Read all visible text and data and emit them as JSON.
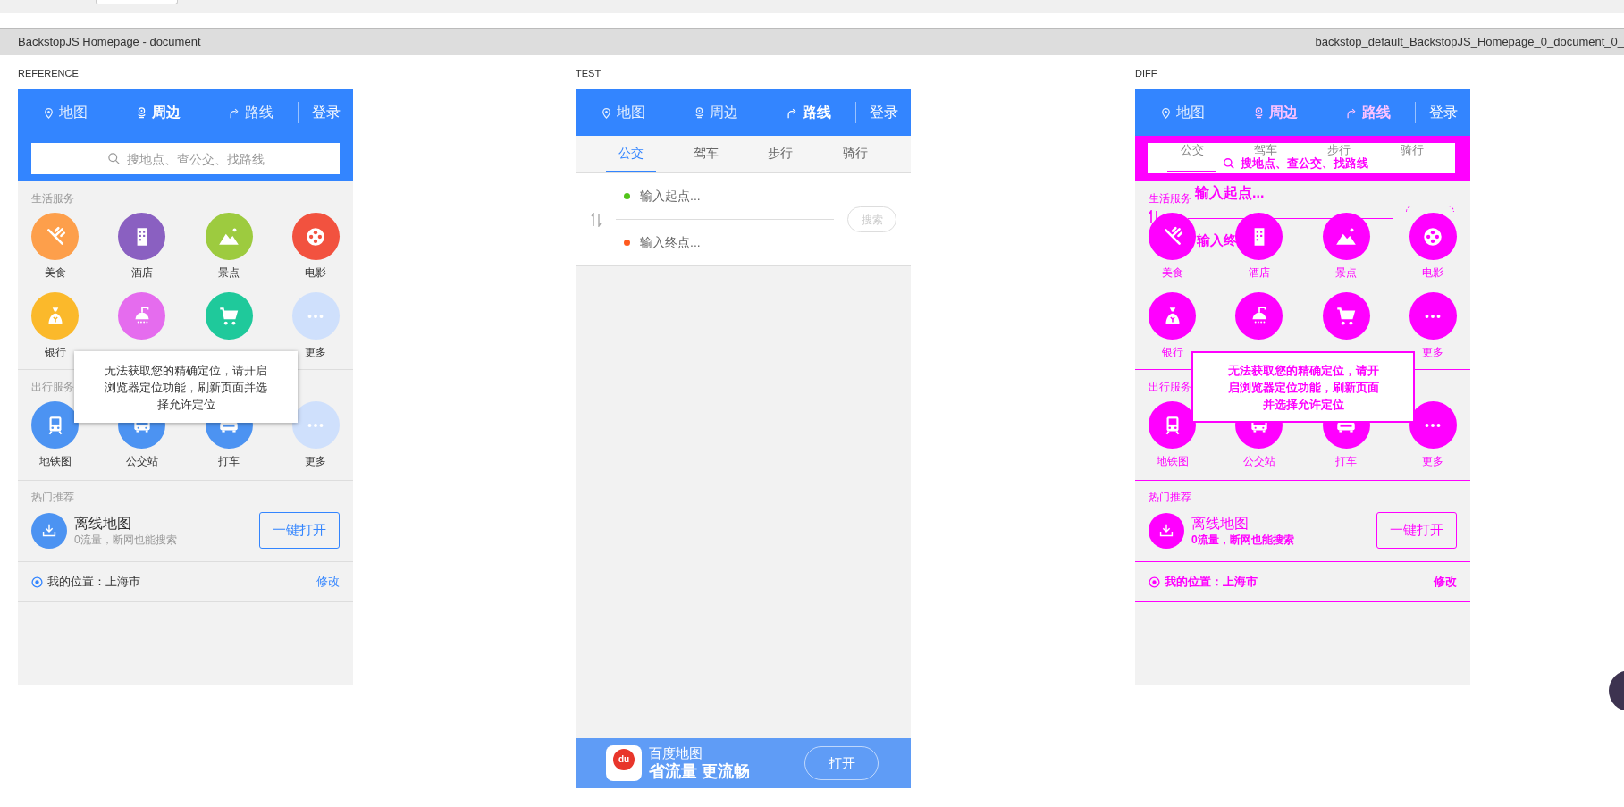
{
  "report": {
    "title": "BackstopJS Homepage - document",
    "file": "backstop_default_BackstopJS_Homepage_0_document_0_"
  },
  "panels": [
    {
      "kind": "reference",
      "label": "REFERENCE",
      "nav": {
        "items": [
          {
            "label": "地图",
            "selected": false
          },
          {
            "label": "周边",
            "selected": true
          },
          {
            "label": "路线",
            "selected": false
          }
        ],
        "login": "登录"
      },
      "search": {
        "placeholder": "搜地点、查公交、找路线"
      },
      "sections": [
        {
          "title": "生活服务",
          "items": [
            {
              "label": "美食",
              "color": "#fd9f4b"
            },
            {
              "label": "酒店",
              "color": "#8a60c1"
            },
            {
              "label": "景点",
              "color": "#9dcb3f"
            },
            {
              "label": "电影",
              "color": "#f2523f"
            },
            {
              "label": "银行",
              "color": "#fbb92b"
            },
            {
              "color": "#e56cee"
            },
            {
              "color": "#1fc99b"
            },
            {
              "label": "更多",
              "color": "#cfe0fc"
            }
          ]
        },
        {
          "title": "出行服务",
          "items": [
            {
              "label": "地铁图",
              "color": "#4c93f2"
            },
            {
              "label": "公交站",
              "color": "#4c93f2"
            },
            {
              "label": "打车",
              "color": "#4c93f2"
            },
            {
              "label": "更多",
              "color": "#cfe0fc"
            }
          ]
        }
      ],
      "recommend": {
        "title": "热门推荐",
        "name": "离线地图",
        "desc": "0流量，断网也能搜索",
        "button": "一键打开"
      },
      "location": {
        "text": "我的位置：上海市",
        "action": "修改"
      },
      "tooltip": "无法获取您的精确定位，请开启浏览器定位功能，刷新页面并选择允许定位"
    },
    {
      "kind": "test",
      "label": "TEST",
      "nav": {
        "items": [
          {
            "label": "地图",
            "selected": false
          },
          {
            "label": "周边",
            "selected": false
          },
          {
            "label": "路线",
            "selected": true
          }
        ],
        "login": "登录"
      },
      "route_tabs": [
        {
          "label": "公交",
          "selected": true
        },
        {
          "label": "驾车",
          "selected": false
        },
        {
          "label": "步行",
          "selected": false
        },
        {
          "label": "骑行",
          "selected": false
        }
      ],
      "start": {
        "placeholder": "输入起点..."
      },
      "end": {
        "placeholder": "输入终点..."
      },
      "search_button": "搜索",
      "banner": {
        "logo_text": "du",
        "app_name": "百度地图",
        "slogan": "省流量 更流畅",
        "button": "打开"
      }
    },
    {
      "kind": "diff",
      "label": "DIFF",
      "nav": {
        "items": [
          {
            "label": "地图",
            "changed": false
          },
          {
            "label": "周边",
            "changed": true
          },
          {
            "label": "路线",
            "changed": true
          }
        ],
        "login": "登录"
      },
      "band": {
        "tabs": [
          {
            "label": "公交",
            "selected": true
          },
          {
            "label": "驾车",
            "selected": false
          },
          {
            "label": "步行",
            "selected": false
          },
          {
            "label": "骑行",
            "selected": false
          }
        ],
        "search_text": "搜地点、查公交、找路线"
      },
      "overlay": {
        "start": "输入起点...",
        "end": "输入终"
      },
      "sections": [
        {
          "title": "生活服务",
          "items": [
            {
              "label": "美食",
              "changed": true
            },
            {
              "label": "酒店",
              "changed": true
            },
            {
              "label": "景点",
              "changed": true
            },
            {
              "label": "电影",
              "changed": true
            },
            {
              "label": "银行",
              "changed": true
            },
            {
              "changed": true
            },
            {
              "changed": true
            },
            {
              "label": "更多",
              "changed": true
            }
          ]
        },
        {
          "title": "出行服务",
          "items": [
            {
              "label": "地铁图",
              "changed": true
            },
            {
              "label": "公交站",
              "changed": true
            },
            {
              "label": "打车",
              "changed": true
            },
            {
              "label": "更多",
              "changed": true
            }
          ]
        }
      ],
      "recommend": {
        "title": "热门推荐",
        "name": "离线地图",
        "desc": "0流量，断网也能搜索",
        "button": "一键打开"
      },
      "location": {
        "text": "我的位置：上海市",
        "action": "修改"
      },
      "tooltip": "无法获取您的精确定位，请开启浏览器定位功能，刷新页面并选择允许定位"
    }
  ]
}
